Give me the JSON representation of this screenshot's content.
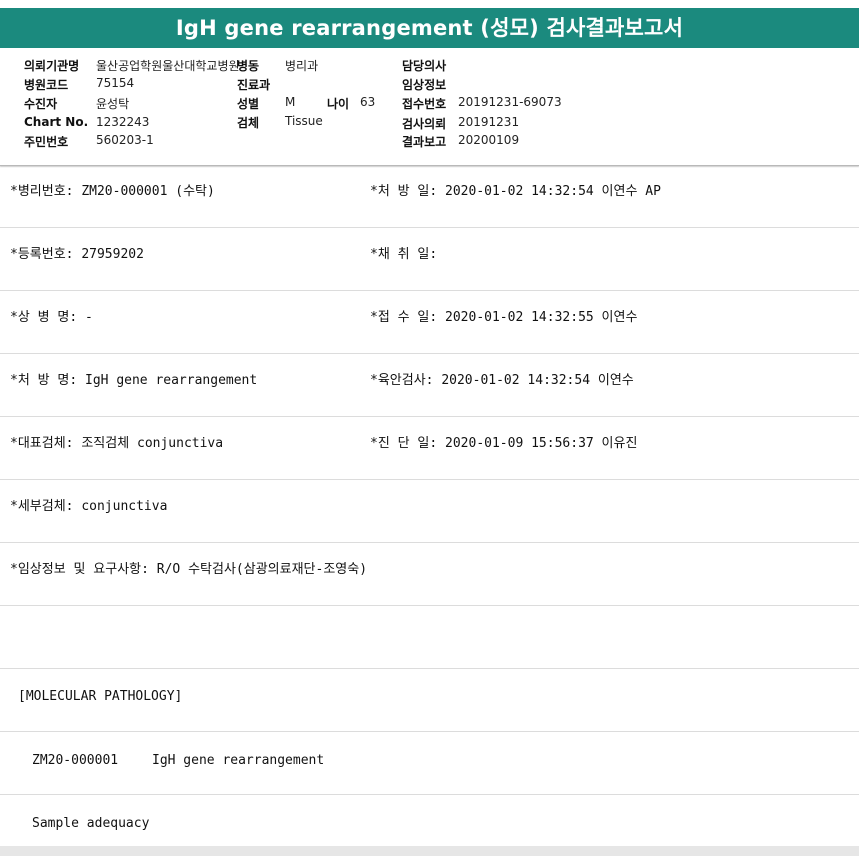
{
  "title": "IgH gene rearrangement (성모) 검사결과보고서",
  "header": {
    "institution_label": "의뢰기관명",
    "institution_value": "울산공업학원울산대학교병원",
    "ward_label": "병동",
    "ward_value": "병리과",
    "doctor_label": "담당의사",
    "hospital_code_label": "병원코드",
    "hospital_code_value": "75154",
    "dept_label": "진료과",
    "clinical_info_label": "임상정보",
    "examinee_label": "수진자",
    "examinee_value": "윤성탁",
    "sex_label": "성별",
    "sex_value": "M",
    "age_label": "나이",
    "age_value": "63",
    "receipt_no_label": "접수번호",
    "receipt_no_value": "20191231-69073",
    "chart_no_label": "Chart No.",
    "chart_no_value": "1232243",
    "specimen_label": "검체",
    "specimen_value": "Tissue",
    "request_date_label": "검사의뢰",
    "request_date_value": "20191231",
    "resident_no_label": "주민번호",
    "resident_no_value": "560203-1",
    "report_date_label": "결과보고",
    "report_date_value": "20200109"
  },
  "rows": [
    {
      "left": "*병리번호: ZM20-000001 (수탁)",
      "right": "*처 방 일: 2020-01-02 14:32:54  이연수 AP"
    },
    {
      "left": "*등록번호: 27959202",
      "right": "*채 취 일:"
    },
    {
      "left": "*상 병 명: -",
      "right": "*접 수 일: 2020-01-02 14:32:55  이연수"
    },
    {
      "left": "*처 방 명: IgH gene rearrangement",
      "right": "*육안검사: 2020-01-02 14:32:54  이연수"
    },
    {
      "left": "*대표검체: 조직검체 conjunctiva",
      "right": "*진 단 일: 2020-01-09 15:56:37  이유진"
    },
    {
      "left": "*세부검체: conjunctiva",
      "right": ""
    },
    {
      "left": "*임상정보 및 요구사항: R/O 수탁검사(삼광의료재단-조영숙)",
      "right": ""
    },
    {
      "left": "",
      "right": ""
    }
  ],
  "body": {
    "section_heading": "[MOLECULAR PATHOLOGY]",
    "case_id": "ZM20-000001",
    "test_name": "IgH gene rearrangement",
    "sample_adequacy": "Sample adequacy"
  }
}
